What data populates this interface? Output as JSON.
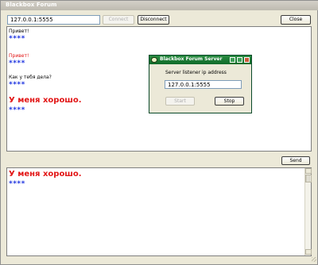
{
  "window": {
    "title": "Blackbox Forum"
  },
  "toolbar": {
    "address_value": "127.0.0.1:5555",
    "connect_label": "Connect",
    "disconnect_label": "Disconnect",
    "close_label": "Close"
  },
  "messages": [
    {
      "text": "Привет!",
      "style": "small"
    },
    {
      "text": "****",
      "style": "stars"
    },
    {
      "text": "Привет!",
      "style": "small-red"
    },
    {
      "text": "****",
      "style": "stars"
    },
    {
      "text": "Как у тебя дела?",
      "style": "small"
    },
    {
      "text": "****",
      "style": "stars"
    },
    {
      "text": "У меня хорошо.",
      "style": "big-red"
    },
    {
      "text": "****",
      "style": "stars"
    }
  ],
  "compose": {
    "send_label": "Send",
    "text": "У меня хорошо.",
    "stars": "****"
  },
  "server_dialog": {
    "title": "Blackbox Forum Server",
    "label": "Server listener ip address",
    "ip_value": "127.0.0.1:5555",
    "start_label": "Start",
    "stop_label": "Stop"
  },
  "colors": {
    "stars": "#1f35e0",
    "red": "#e21616",
    "dialog_title": "#1a7a33"
  }
}
